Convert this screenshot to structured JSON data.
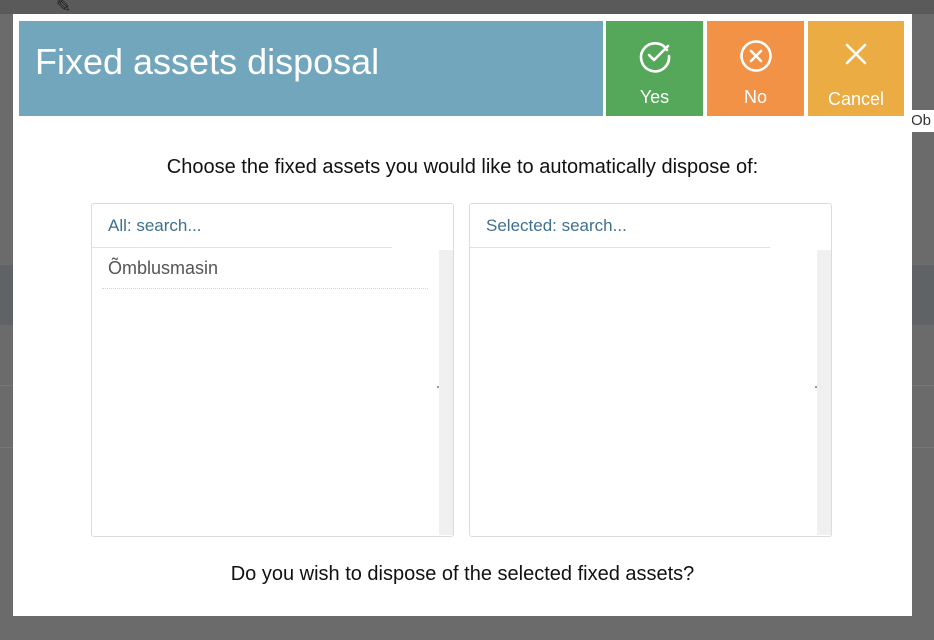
{
  "background": {
    "partial_text": "Ob"
  },
  "dialog": {
    "title": "Fixed assets disposal",
    "buttons": {
      "yes": "Yes",
      "no": "No",
      "cancel": "Cancel"
    },
    "prompt": "Choose the fixed assets you would like to automatically dispose of:",
    "available": {
      "placeholder": "All: search...",
      "items": [
        "Õmblusmasin"
      ]
    },
    "selected": {
      "placeholder": "Selected: search...",
      "items": []
    },
    "question": "Do you wish to dispose of the selected fixed assets?"
  },
  "colors": {
    "header": "#72a6bc",
    "yes": "#55a85a",
    "no": "#f29247",
    "cancel": "#ebac43",
    "overlay": "#6b6b6b"
  }
}
